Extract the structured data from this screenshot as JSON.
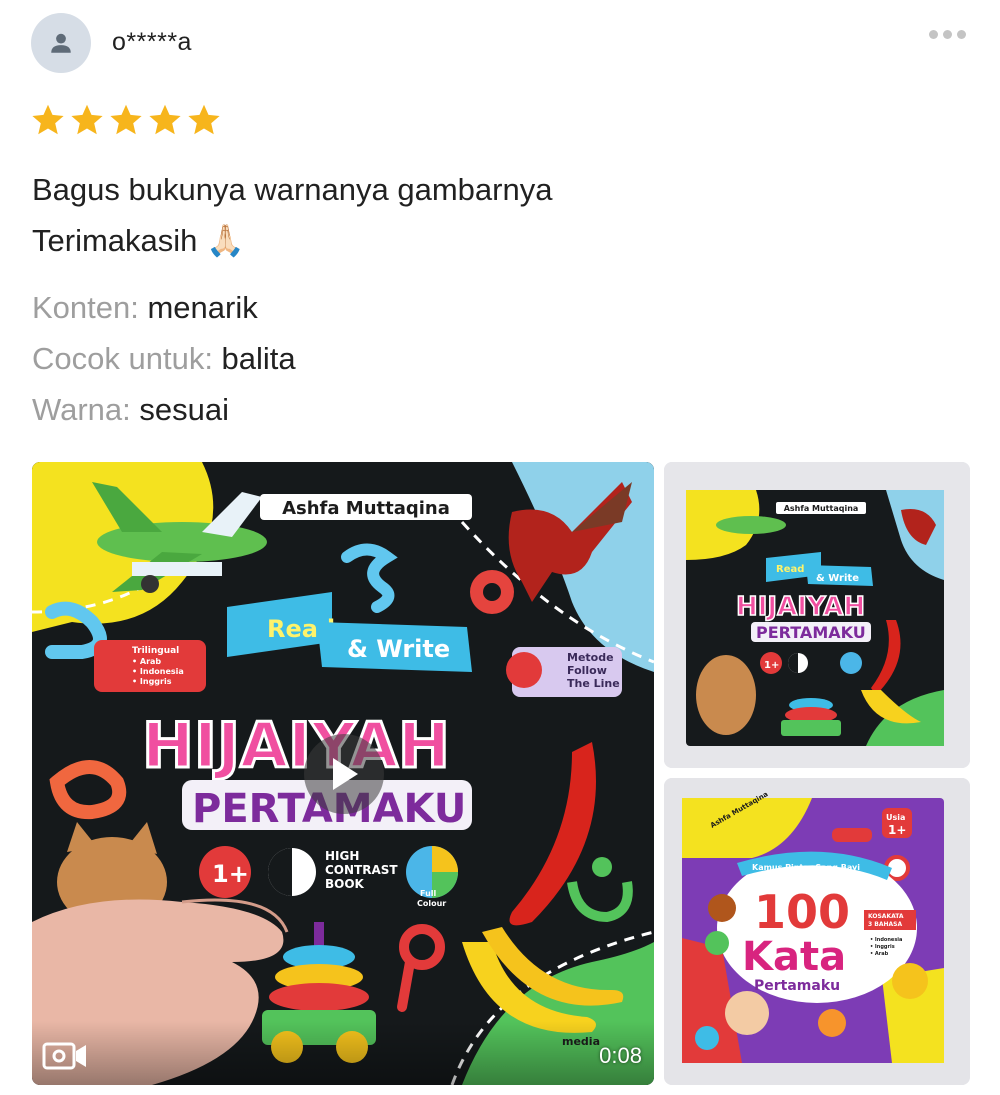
{
  "review": {
    "username": "o*****a",
    "rating": 5,
    "text_lines": [
      "Bagus bukunya warnanya gambarnya",
      "Terimakasih 🙏🏻"
    ],
    "attributes": [
      {
        "key": "Konten: ",
        "value": "menarik"
      },
      {
        "key": "Cocok untuk: ",
        "value": "balita"
      },
      {
        "key": "Warna: ",
        "value": "sesuai"
      }
    ]
  },
  "media": {
    "video_duration": "0:08",
    "cover": {
      "author": "Ashfa Muttaqina",
      "read": "Read",
      "write": "& Write",
      "title_line1": "HIJAIYAH",
      "title_line2": "PERTAMAKU",
      "badge_age": "1+",
      "badge_contrast_lines": [
        "HIGH",
        "CONTRAST",
        "BOOK"
      ],
      "badge_colour_lines": [
        "Full",
        "Colour"
      ],
      "metode_lines": [
        "Metode",
        "Follow",
        "The Line"
      ],
      "trilingual_lines": [
        "Trilingual",
        "• Arab",
        "• Indonesia",
        "• Inggris"
      ],
      "publisher": "media"
    },
    "cover2": {
      "author": "Ashfa Muttaqina",
      "subtitle": "Kamus Pintar Sang Bayi",
      "title_num": "100",
      "title_word": "Kata",
      "title_sub": "Pertamaku",
      "age_label": "Usia",
      "age": "1+",
      "kosakata_lines": [
        "KOSAKATA",
        "3 BAHASA"
      ],
      "languages": [
        "• Indonesia",
        "• Inggris",
        "• Arab"
      ]
    }
  },
  "colors": {
    "star": "#f7b51c",
    "muted": "#9e9e9e",
    "text": "#212121"
  }
}
